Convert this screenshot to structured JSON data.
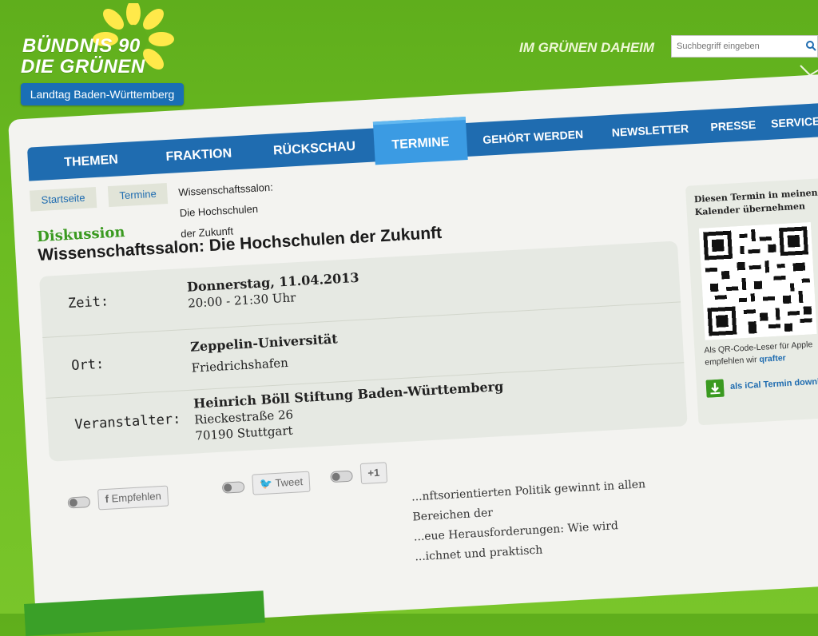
{
  "header": {
    "logo_line1": "BÜNDNIS 90",
    "logo_line2": "DIE GRÜNEN",
    "landtag_label": "Landtag Baden-Württemberg",
    "slogan": "IM GRÜNEN DAHEIM",
    "search_placeholder": "Suchbegriff eingeben"
  },
  "nav": {
    "items": [
      {
        "label": "THEMEN"
      },
      {
        "label": "FRAKTION"
      },
      {
        "label": "RÜCKSCHAU"
      },
      {
        "label": "TERMINE",
        "active": true
      },
      {
        "label": "GEHÖRT WERDEN"
      },
      {
        "label": "NEWSLETTER"
      },
      {
        "label": "PRESSE"
      },
      {
        "label": "SERVICE"
      }
    ]
  },
  "breadcrumb": {
    "home": "Startseite",
    "section": "Termine",
    "current": "Wissenschaftssalon: Die Hochschulen der Zukunft"
  },
  "event": {
    "kind": "Diskussion",
    "title": "Wissenschaftssalon: Die Hochschulen der Zukunft",
    "zeit_label": "Zeit:",
    "zeit_date": "Donnerstag, 11.04.2013",
    "zeit_time": "20:00 - 21:30 Uhr",
    "ort_label": "Ort:",
    "ort_name": "Zeppelin-Universität",
    "ort_city": "Friedrichshafen",
    "veranstalter_label": "Veranstalter:",
    "veranstalter_name": "Heinrich Böll Stiftung Baden-Württemberg",
    "veranstalter_street": "Rieckestraße 26",
    "veranstalter_city": "70190 Stuttgart"
  },
  "social": {
    "facebook_label": "Empfehlen",
    "twitter_label": "Tweet",
    "gplus_label": "+1"
  },
  "sidebar": {
    "title": "Diesen Termin in meinen Kalender übernehmen",
    "qr_text": "Als QR-Code-Leser für Apple empfehlen wir",
    "qr_link": "qrafter",
    "ical_label": "als iCal Termin downloaden"
  },
  "body_text": {
    "line1": "...nftsorientierten Politik gewinnt in allen Bereichen der",
    "line2": "...eue Herausforderungen: Wie wird",
    "line3": "...ichnet und praktisch"
  },
  "colors": {
    "green_bg": "#6cbc22",
    "nav_blue": "#1f6cb0",
    "nav_active": "#3b9be3",
    "accent_green": "#3a9a20"
  }
}
